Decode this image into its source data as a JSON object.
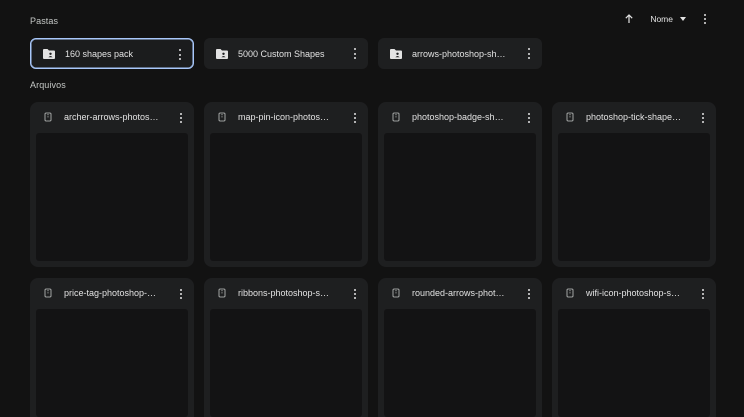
{
  "sections": {
    "folders_title": "Pastas",
    "files_title": "Arquivos"
  },
  "toolbar": {
    "sort_arrow_icon": "arrow-up-icon",
    "sort_label": "Nome",
    "more_icon": "more-vert-icon"
  },
  "folders": [
    {
      "name": "160 shapes pack",
      "icon": "shared-folder-icon",
      "selected": true
    },
    {
      "name": "5000 Custom Shapes",
      "icon": "shared-folder-icon",
      "selected": false
    },
    {
      "name": "arrows-photoshop-sh…",
      "icon": "shared-folder-icon",
      "selected": false
    }
  ],
  "files": [
    {
      "name": "archer-arrows-photos…",
      "icon": "zip-file-icon"
    },
    {
      "name": "map-pin-icon-photos…",
      "icon": "zip-file-icon"
    },
    {
      "name": "photoshop-badge-sh…",
      "icon": "zip-file-icon"
    },
    {
      "name": "photoshop-tick-shape…",
      "icon": "zip-file-icon"
    },
    {
      "name": "price-tag-photoshop-…",
      "icon": "zip-file-icon"
    },
    {
      "name": "ribbons-photoshop-s…",
      "icon": "zip-file-icon"
    },
    {
      "name": "rounded-arrows-phot…",
      "icon": "zip-file-icon"
    },
    {
      "name": "wifi-icon-photoshop-s…",
      "icon": "zip-file-icon"
    }
  ],
  "colors": {
    "background": "#121212",
    "card": "#1e1f20",
    "thumbnail": "#131314",
    "selected_border": "#a8c7fa",
    "text": "#e3e3e3"
  }
}
